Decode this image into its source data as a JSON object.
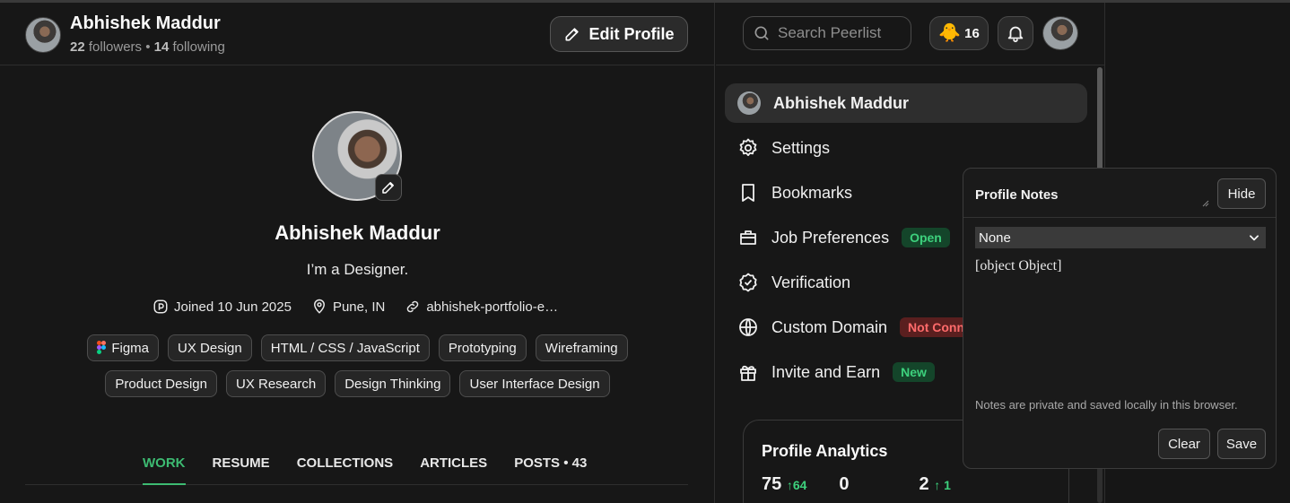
{
  "header": {
    "name": "Abhishek Maddur",
    "followers_count": "22",
    "followers_label": "followers •",
    "following_count": "14",
    "following_label": "following",
    "edit_profile_label": "Edit Profile"
  },
  "profile": {
    "name": "Abhishek Maddur",
    "bio": "I’m a Designer.",
    "joined": "Joined 10 Jun 2025",
    "location": "Pune, IN",
    "website": "abhishek-portfolio-e…"
  },
  "skills_row1": [
    "Figma",
    "UX Design",
    "HTML / CSS / JavaScript",
    "Prototyping",
    "Wireframing"
  ],
  "skills_row2": [
    "Product Design",
    "UX Research",
    "Design Thinking",
    "User Interface Design"
  ],
  "tabs": [
    "WORK",
    "RESUME",
    "COLLECTIONS",
    "ARTICLES",
    "POSTS • 43"
  ],
  "topnav": {
    "search_placeholder": "Search Peerlist",
    "coin_count": "16"
  },
  "menu": {
    "user": "Abhishek Maddur",
    "settings": "Settings",
    "bookmarks": "Bookmarks",
    "job_preferences": "Job Preferences",
    "job_badge": "Open",
    "verification": "Verification",
    "custom_domain": "Custom Domain",
    "custom_domain_badge": "Not Conn",
    "invite": "Invite and Earn",
    "invite_badge": "New"
  },
  "analytics": {
    "title": "Profile Analytics",
    "stat1": "75",
    "stat1_delta": "↑64",
    "stat2": "0",
    "stat3": "2",
    "stat3_delta": "↑ 1"
  },
  "notes": {
    "title": "Profile Notes",
    "hide_label": "Hide",
    "select_value": "None",
    "text": "[object Object]",
    "footer": "Notes are private and saved locally in this browser.",
    "clear_label": "Clear",
    "save_label": "Save"
  },
  "colors": {
    "accent_green": "#3dbb72",
    "background": "#171717"
  }
}
